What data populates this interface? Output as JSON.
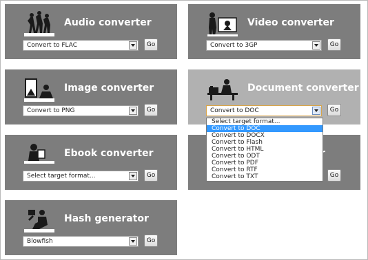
{
  "cards": [
    {
      "title": "Audio converter",
      "select_value": "Convert to FLAC",
      "go": "Go",
      "icon": "dancing-figures-icon"
    },
    {
      "title": "Video converter",
      "select_value": "Convert to 3GP",
      "go": "Go",
      "icon": "person-at-screen-icon"
    },
    {
      "title": "Image converter",
      "select_value": "Convert to PNG",
      "go": "Go",
      "icon": "framed-picture-icon"
    },
    {
      "title": "Document converter",
      "select_value": "Convert to DOC",
      "go": "Go",
      "icon": "person-at-desk-icon"
    },
    {
      "title": "Ebook converter",
      "select_value": "Select target format...",
      "go": "Go",
      "icon": "person-reading-icon"
    },
    {
      "title_visible_suffix": "r",
      "go": "Go"
    },
    {
      "title": "Hash generator",
      "select_value": "Blowfish",
      "go": "Go",
      "icon": "person-with-stamp-icon"
    }
  ],
  "document_dropdown": {
    "options": [
      "Select target format...",
      "Convert to DOC",
      "Convert to DOCX",
      "Convert to Flash",
      "Convert to HTML",
      "Convert to ODT",
      "Convert to PDF",
      "Convert to RTF",
      "Convert to TXT"
    ],
    "highlighted_index": 1
  },
  "colors": {
    "card_bg": "#7d7d7d",
    "card_active_bg": "#b1b1b1",
    "highlight": "#3399ff"
  }
}
